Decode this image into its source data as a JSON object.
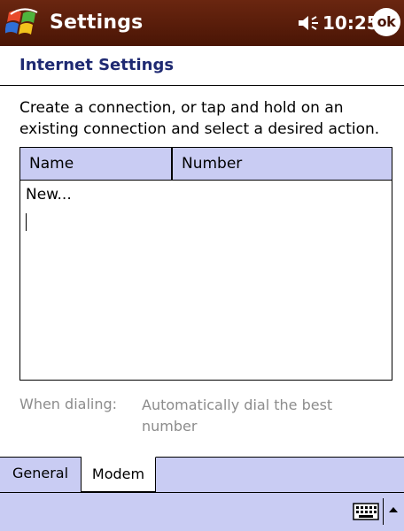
{
  "titlebar": {
    "app_title": "Settings",
    "time": "10:25",
    "ok_label": "ok",
    "start_icon": "windows-flag-icon",
    "volume_icon": "speaker-icon"
  },
  "page": {
    "header": "Internet Settings",
    "instructions": "Create a connection, or tap and hold on an existing connection and select a desired action."
  },
  "connections": {
    "columns": [
      "Name",
      "Number"
    ],
    "rows": [
      "New..."
    ]
  },
  "dialing": {
    "label": "When dialing:",
    "value": "Automatically dial the best number"
  },
  "tabs": [
    {
      "label": "General",
      "selected": false
    },
    {
      "label": "Modem",
      "selected": true
    }
  ],
  "command_bar": {
    "input_icon": "keyboard-icon",
    "menu_icon": "up-arrow-icon"
  },
  "colors": {
    "titlebar": "#4a1505",
    "header_text": "#1f2a72",
    "list_header": "#c9ccf3",
    "muted_text": "#8c8c8c"
  }
}
